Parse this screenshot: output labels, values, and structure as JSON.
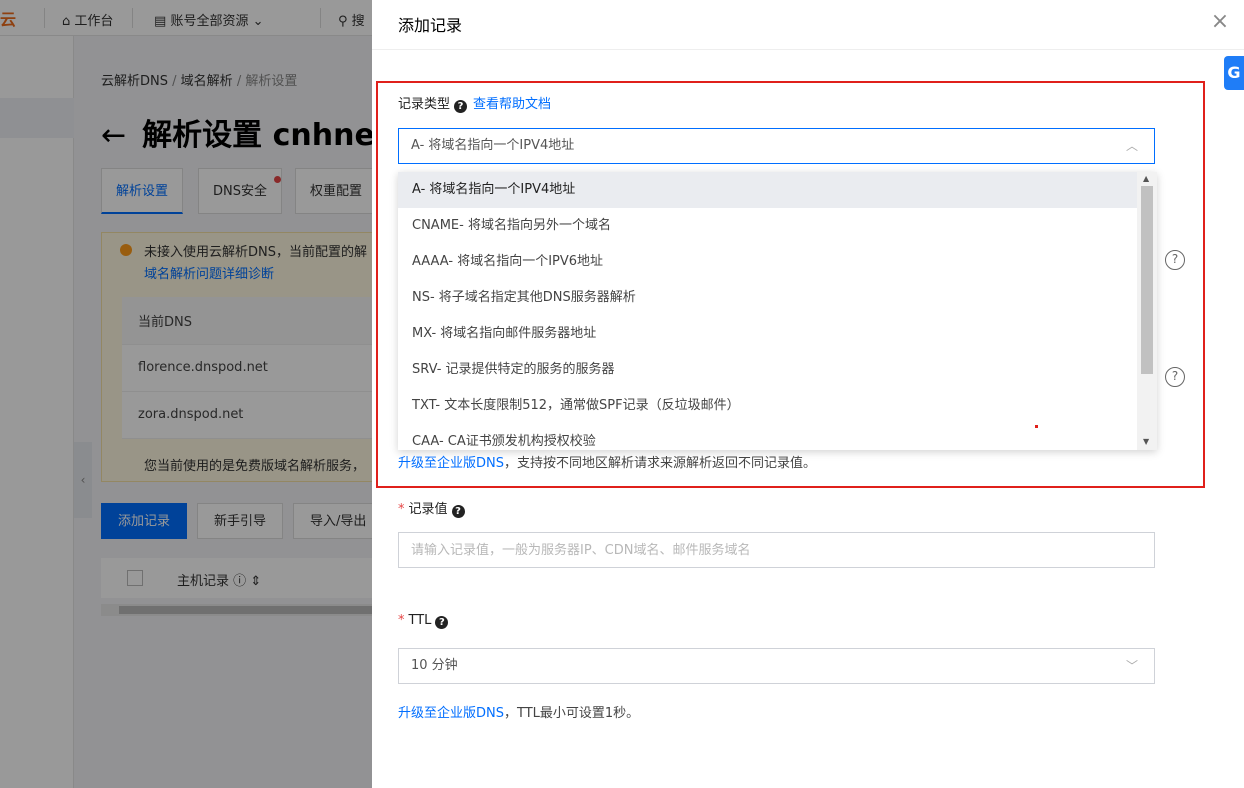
{
  "background": {
    "topnav": {
      "logo": "云",
      "workbench": "工作台",
      "resources": "账号全部资源",
      "search_stub": "搜"
    },
    "breadcrumb": {
      "root": "云解析DNS",
      "sep": "/",
      "mid": "域名解析",
      "current": "解析设置"
    },
    "page_title": "解析设置 cnhne",
    "tabs": [
      "解析设置",
      "DNS安全",
      "权重配置"
    ],
    "alert": {
      "line1": "未接入使用云解析DNS，当前配置的解",
      "line2": "域名解析问题详细诊断",
      "dns_header": "当前DNS",
      "dns_rows": [
        "florence.dnspod.net",
        "zora.dnspod.net"
      ],
      "footer": "您当前使用的是免费版域名解析服务，"
    },
    "actions": {
      "add": "添加记录",
      "guide": "新手引导",
      "import": "导入/导出"
    },
    "table": {
      "host_col": "主机记录"
    }
  },
  "drawer": {
    "title": "添加记录",
    "record_type": {
      "label": "记录类型",
      "help_link": "查看帮助文档",
      "selected": "A- 将域名指向一个IPV4地址",
      "options": [
        "A- 将域名指向一个IPV4地址",
        "CNAME- 将域名指向另外一个域名",
        "AAAA- 将域名指向一个IPV6地址",
        "NS- 将子域名指定其他DNS服务器解析",
        "MX- 将域名指向邮件服务器地址",
        "SRV- 记录提供特定的服务的服务器",
        "TXT- 文本长度限制512，通常做SPF记录（反垃圾邮件）",
        "CAA- CA证书颁发机构授权校验"
      ]
    },
    "line_note": {
      "link": "升级至企业版DNS",
      "text": "，支持按不同地区解析请求来源解析返回不同记录值。"
    },
    "record_value": {
      "label": "记录值",
      "placeholder": "请输入记录值，一般为服务器IP、CDN域名、邮件服务域名"
    },
    "ttl": {
      "label": "TTL",
      "value": "10 分钟"
    },
    "ttl_note": {
      "link": "升级至企业版DNS",
      "text": "，TTL最小可设置1秒。"
    }
  }
}
